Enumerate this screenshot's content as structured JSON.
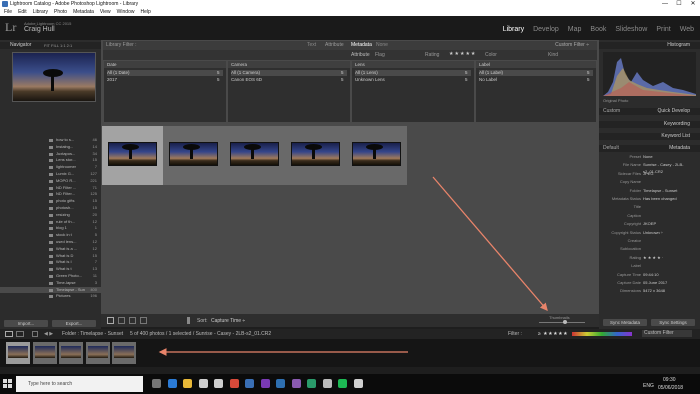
{
  "window": {
    "title": "Lightroom Catalog - Adobe Photoshop Lightroom - Library",
    "min": "—",
    "max": "☐",
    "close": "✕"
  },
  "menu": [
    "File",
    "Edit",
    "Library",
    "Photo",
    "Metadata",
    "View",
    "Window",
    "Help"
  ],
  "identity": {
    "logo": "Lr",
    "product": "Adobe Lightroom CC 2015",
    "user": "Craig Hull"
  },
  "modules": [
    "Library",
    "Develop",
    "Map",
    "Book",
    "Slideshow",
    "Print",
    "Web"
  ],
  "active_module": "Library",
  "left_panel": {
    "navigator": "Navigator",
    "nav_zoom": "FIT   FILL   1:1   2:1",
    "folders": [
      {
        "name": "how to s...",
        "count": "46"
      },
      {
        "name": "Instalng...",
        "count": "14"
      },
      {
        "name": "Juxtapos...",
        "count": "34"
      },
      {
        "name": "Lens stor...",
        "count": "15"
      },
      {
        "name": "lightroomer",
        "count": "7"
      },
      {
        "name": "Lumix G...",
        "count": "127"
      },
      {
        "name": "MOPO R...",
        "count": "221"
      },
      {
        "name": "ND Filter ...",
        "count": "71"
      },
      {
        "name": "ND Filter...",
        "count": "125"
      },
      {
        "name": "photo gifts",
        "count": "15"
      },
      {
        "name": "photosh...",
        "count": "15"
      },
      {
        "name": "resizing",
        "count": "20"
      },
      {
        "name": "rule of th...",
        "count": "12"
      },
      {
        "name": "blog 1",
        "count": "1"
      },
      {
        "name": "stock in t",
        "count": "5"
      },
      {
        "name": "used lens...",
        "count": "12"
      },
      {
        "name": "What is a ...",
        "count": "12"
      },
      {
        "name": "What is D",
        "count": "15"
      },
      {
        "name": "What is I",
        "count": "7"
      },
      {
        "name": "What is t",
        "count": "13"
      },
      {
        "name": "Green Photo...",
        "count": "11"
      },
      {
        "name": "Time-lapse",
        "count": "3"
      },
      {
        "name": "Timelapse - Sun",
        "count": "400"
      },
      {
        "name": "Pictures",
        "count": "196"
      }
    ],
    "import": "Import...",
    "export": "Export..."
  },
  "filter": {
    "title": "Library Filter :",
    "tabs": [
      "Text",
      "Attribute",
      "Metadata",
      "None"
    ],
    "active_tab": "Metadata",
    "custom": "Custom Filter ÷",
    "attr_label": "Attribute",
    "flag_label": "Flag",
    "rating_label": "Rating",
    "edit_label": "Edit",
    "color_label": "Color",
    "kind_label": "Kind",
    "columns": [
      {
        "header": "Date",
        "rows": [
          {
            "label": "All (1 Date)",
            "count": "5"
          },
          {
            "label": "2017",
            "count": "5"
          }
        ]
      },
      {
        "header": "Camera",
        "rows": [
          {
            "label": "All (1 Camera)",
            "count": "5"
          },
          {
            "label": "Canon EOS 6D",
            "count": "5"
          }
        ]
      },
      {
        "header": "Lens",
        "rows": [
          {
            "label": "All (1 Lens)",
            "count": "5"
          },
          {
            "label": "Unknown Lens",
            "count": "5"
          }
        ]
      },
      {
        "header": "Label",
        "rows": [
          {
            "label": "All (1 Label)",
            "count": "5"
          },
          {
            "label": "No Label",
            "count": "5"
          }
        ]
      }
    ]
  },
  "toolbar": {
    "sort_label": "Sort:",
    "sort_value": "Capture Time ÷",
    "thumbs_label": "Thumbnails"
  },
  "right_panel": {
    "histogram": "Histogram",
    "original_photo": "Original Photo",
    "preset_label": "Custom",
    "quick_develop": "Quick Develop",
    "keywording": "Keywording",
    "keyword_list": "Keyword List",
    "metadata_title": "Metadata",
    "metadata_preset": "Default",
    "meta": [
      {
        "label": "Preset",
        "value": "None"
      },
      {
        "label": "File Name",
        "value": "Sunrise - Casey - 2LB-s2_01.CR2"
      },
      {
        "label": "Sidecar Files",
        "value": "JPEG"
      },
      {
        "label": "Copy Name",
        "value": ""
      },
      {
        "label": "Folder",
        "value": "Timelapse - Sunset"
      },
      {
        "label": "Metadata Status",
        "value": "Has been changed"
      },
      {
        "label": "Title",
        "value": ""
      },
      {
        "label": "Caption",
        "value": ""
      },
      {
        "label": "Copyright",
        "value": "JKOEP"
      },
      {
        "label": "Copyright Status",
        "value": "Unknown ÷"
      },
      {
        "label": "Creator",
        "value": ""
      },
      {
        "label": "Sublocation",
        "value": ""
      },
      {
        "label": "Rating",
        "value": "★ ★ ★ ★ ·"
      },
      {
        "label": "Label",
        "value": ""
      },
      {
        "label": "Capture Time",
        "value": "09:44:10"
      },
      {
        "label": "Capture Date",
        "value": "05 June 2017"
      },
      {
        "label": "Dimensions",
        "value": "5472 x 3648"
      }
    ],
    "sync_metadata": "Sync Metadata",
    "sync_settings": "Sync Settings"
  },
  "filmstrip": {
    "path": "Folder : Timelapse - Sunset",
    "status": "5 of 400 photos / 1 selected / Sunrise - Casey - 2LB-s2_01.CR2",
    "filter_label": "Filter :",
    "custom_filter": "Custom Filter"
  },
  "taskbar": {
    "search": "Type here to search",
    "lang": "ENG",
    "time": "09:30",
    "date": "05/06/2018"
  },
  "colors": {
    "accent_arrow": "#e8846a"
  }
}
